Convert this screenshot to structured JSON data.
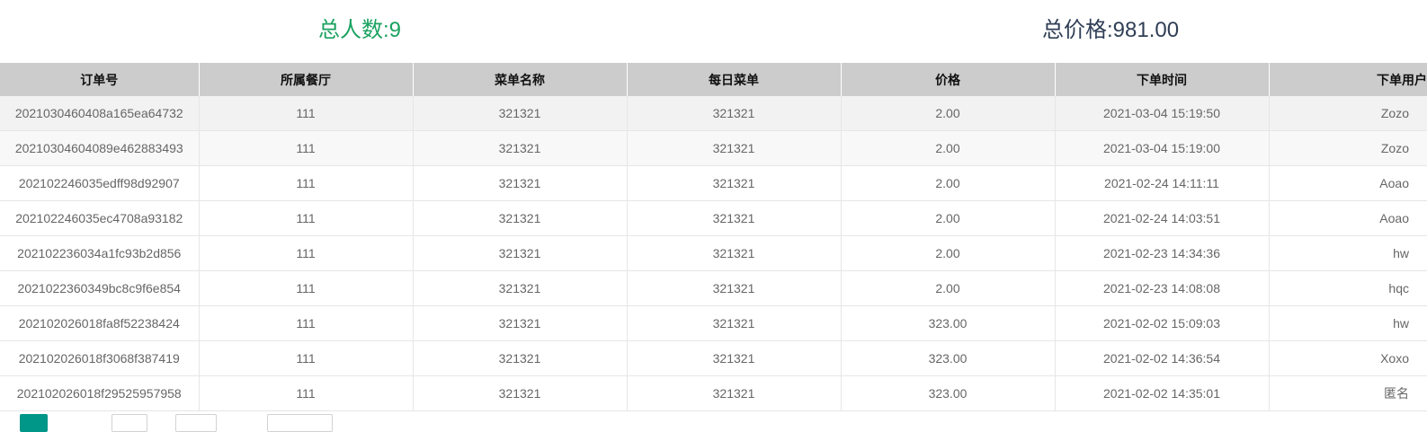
{
  "summary": {
    "total_people": "总人数:9",
    "total_price": "总价格:981.00"
  },
  "table": {
    "headers": [
      "订单号",
      "所属餐厅",
      "菜单名称",
      "每日菜单",
      "价格",
      "下单时间",
      "下单用户"
    ],
    "rows": [
      [
        "2021030460408a165ea64732",
        "111",
        "321321",
        "321321",
        "2.00",
        "2021-03-04 15:19:50",
        "Zozo"
      ],
      [
        "20210304604089e462883493",
        "111",
        "321321",
        "321321",
        "2.00",
        "2021-03-04 15:19:00",
        "Zozo"
      ],
      [
        "202102246035edff98d92907",
        "111",
        "321321",
        "321321",
        "2.00",
        "2021-02-24 14:11:11",
        "Aoao"
      ],
      [
        "202102246035ec4708a93182",
        "111",
        "321321",
        "321321",
        "2.00",
        "2021-02-24 14:03:51",
        "Aoao"
      ],
      [
        "202102236034a1fc93b2d856",
        "111",
        "321321",
        "321321",
        "2.00",
        "2021-02-23 14:34:36",
        "hw"
      ],
      [
        "2021022360349bc8c9f6e854",
        "111",
        "321321",
        "321321",
        "2.00",
        "2021-02-23 14:08:08",
        "hqc"
      ],
      [
        "202102026018fa8f52238424",
        "111",
        "321321",
        "321321",
        "323.00",
        "2021-02-02 15:09:03",
        "hw"
      ],
      [
        "202102026018f3068f387419",
        "111",
        "321321",
        "321321",
        "323.00",
        "2021-02-02 14:36:54",
        "Xoxo"
      ],
      [
        "202102026018f29525957958",
        "111",
        "321321",
        "321321",
        "323.00",
        "2021-02-02 14:35:01",
        "匿名"
      ]
    ]
  },
  "colors": {
    "people_text": "#1aa260",
    "price_text": "#2f3e55",
    "header_bg": "#cccccc",
    "pager_active": "#009688"
  }
}
